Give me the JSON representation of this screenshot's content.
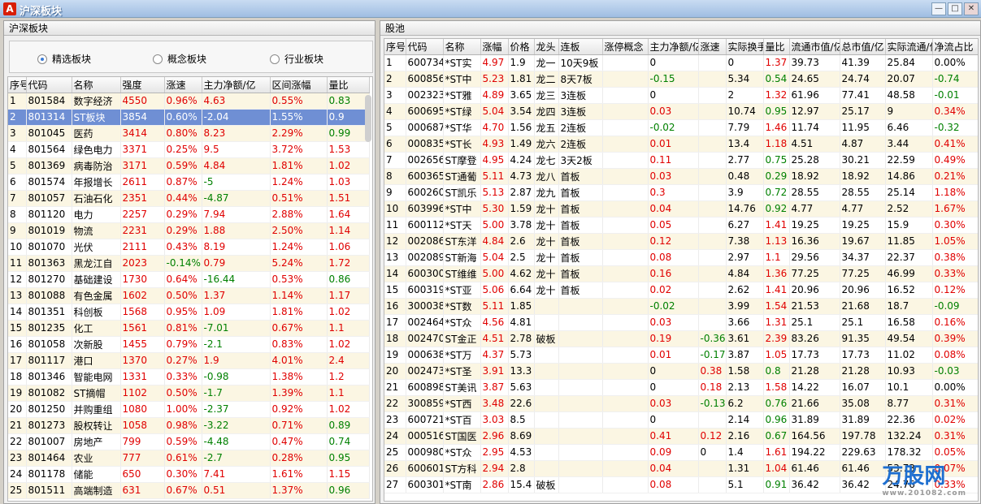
{
  "window": {
    "title": "沪深板块",
    "app_icon_letter": "A"
  },
  "left": {
    "panel_title": "沪深板块",
    "radios": [
      {
        "label": "精选板块",
        "checked": true
      },
      {
        "label": "概念板块",
        "checked": false
      },
      {
        "label": "行业板块",
        "checked": false
      }
    ],
    "columns": [
      "序号",
      "代码",
      "名称",
      "强度",
      "涨速",
      "主力净额/亿",
      "区间涨幅",
      "量比"
    ],
    "rows": [
      [
        "1",
        "801584",
        "数字经济",
        "4550",
        "0.96%",
        "4.63",
        "0.55%",
        "0.83"
      ],
      [
        "2",
        "801314",
        "ST板块",
        "3854",
        "0.60%",
        "-2.04",
        "1.55%",
        "0.9"
      ],
      [
        "3",
        "801045",
        "医药",
        "3414",
        "0.80%",
        "8.23",
        "2.29%",
        "0.99"
      ],
      [
        "4",
        "801564",
        "绿色电力",
        "3371",
        "0.25%",
        "9.5",
        "3.72%",
        "1.53"
      ],
      [
        "5",
        "801369",
        "病毒防治",
        "3171",
        "0.59%",
        "4.84",
        "1.81%",
        "1.02"
      ],
      [
        "6",
        "801574",
        "年报增长",
        "2611",
        "0.87%",
        "-5",
        "1.24%",
        "1.03"
      ],
      [
        "7",
        "801057",
        "石油石化",
        "2351",
        "0.44%",
        "-4.87",
        "0.51%",
        "1.51"
      ],
      [
        "8",
        "801120",
        "电力",
        "2257",
        "0.29%",
        "7.94",
        "2.88%",
        "1.64"
      ],
      [
        "9",
        "801019",
        "物流",
        "2231",
        "0.29%",
        "1.88",
        "2.50%",
        "1.14"
      ],
      [
        "10",
        "801070",
        "光伏",
        "2111",
        "0.43%",
        "8.19",
        "1.24%",
        "1.06"
      ],
      [
        "11",
        "801363",
        "黑龙江自",
        "2023",
        "-0.14%",
        "0.79",
        "5.24%",
        "1.72"
      ],
      [
        "12",
        "801270",
        "基础建设",
        "1730",
        "0.64%",
        "-16.44",
        "0.53%",
        "0.86"
      ],
      [
        "13",
        "801088",
        "有色金属",
        "1602",
        "0.50%",
        "1.37",
        "1.14%",
        "1.17"
      ],
      [
        "14",
        "801351",
        "科创板",
        "1568",
        "0.95%",
        "1.09",
        "1.81%",
        "1.02"
      ],
      [
        "15",
        "801235",
        "化工",
        "1561",
        "0.81%",
        "-7.01",
        "0.67%",
        "1.1"
      ],
      [
        "16",
        "801058",
        "次新股",
        "1455",
        "0.79%",
        "-2.1",
        "0.83%",
        "1.02"
      ],
      [
        "17",
        "801117",
        "港口",
        "1370",
        "0.27%",
        "1.9",
        "4.01%",
        "2.4"
      ],
      [
        "18",
        "801346",
        "智能电网",
        "1331",
        "0.33%",
        "-0.98",
        "1.38%",
        "1.2"
      ],
      [
        "19",
        "801082",
        "ST摘帽",
        "1102",
        "0.50%",
        "-1.7",
        "1.39%",
        "1.1"
      ],
      [
        "20",
        "801250",
        "并购重组",
        "1080",
        "1.00%",
        "-2.37",
        "0.92%",
        "1.02"
      ],
      [
        "21",
        "801273",
        "股权转让",
        "1058",
        "0.98%",
        "-3.22",
        "0.71%",
        "0.89"
      ],
      [
        "22",
        "801007",
        "房地产",
        "799",
        "0.59%",
        "-4.48",
        "0.47%",
        "0.74"
      ],
      [
        "23",
        "801464",
        "农业",
        "777",
        "0.61%",
        "-2.7",
        "0.28%",
        "0.95"
      ],
      [
        "24",
        "801178",
        "储能",
        "650",
        "0.30%",
        "7.41",
        "1.61%",
        "1.15"
      ],
      [
        "25",
        "801511",
        "高端制造",
        "631",
        "0.67%",
        "0.51",
        "1.37%",
        "0.96"
      ]
    ]
  },
  "right": {
    "panel_title": "股池",
    "columns": [
      "序号",
      "代码",
      "名称",
      "涨幅",
      "价格",
      "龙头",
      "连板",
      "涨停概念",
      "主力净额/亿",
      "涨速",
      "实际换手",
      "量比",
      "流通市值/亿",
      "总市值/亿",
      "实际流通/亿",
      "净流占比"
    ],
    "rows": [
      [
        "1",
        "600734",
        "*ST实",
        "4.97",
        "1.9",
        "龙一",
        "10天9板",
        "",
        "0",
        "",
        "0",
        "1.37",
        "39.73",
        "41.39",
        "25.84",
        "0.00%"
      ],
      [
        "2",
        "600856",
        "*ST中",
        "5.23",
        "1.81",
        "龙二",
        "8天7板",
        "",
        "-0.15",
        "",
        "5.34",
        "0.54",
        "24.65",
        "24.74",
        "20.07",
        "-0.74"
      ],
      [
        "3",
        "002323",
        "*ST雅",
        "4.89",
        "3.65",
        "龙三",
        "3连板",
        "",
        "0",
        "",
        "2",
        "1.32",
        "61.96",
        "77.41",
        "48.58",
        "-0.01"
      ],
      [
        "4",
        "600695",
        "*ST绿",
        "5.04",
        "3.54",
        "龙四",
        "3连板",
        "",
        "0.03",
        "",
        "10.74",
        "0.95",
        "12.97",
        "25.17",
        "9",
        "0.34%"
      ],
      [
        "5",
        "000687",
        "*ST华",
        "4.70",
        "1.56",
        "龙五",
        "2连板",
        "",
        "-0.02",
        "",
        "7.79",
        "1.46",
        "11.74",
        "11.95",
        "6.46",
        "-0.32"
      ],
      [
        "6",
        "000835",
        "*ST长",
        "4.93",
        "1.49",
        "龙六",
        "2连板",
        "",
        "0.01",
        "",
        "13.4",
        "1.18",
        "4.51",
        "4.87",
        "3.44",
        "0.41%"
      ],
      [
        "7",
        "002656",
        "ST摩登",
        "4.95",
        "4.24",
        "龙七",
        "3天2板",
        "",
        "0.11",
        "",
        "2.77",
        "0.75",
        "25.28",
        "30.21",
        "22.59",
        "0.49%"
      ],
      [
        "8",
        "600365",
        "ST通葡",
        "5.11",
        "4.73",
        "龙八",
        "首板",
        "",
        "0.03",
        "",
        "0.48",
        "0.29",
        "18.92",
        "18.92",
        "14.86",
        "0.21%"
      ],
      [
        "9",
        "600260",
        "ST凯乐",
        "5.13",
        "2.87",
        "龙九",
        "首板",
        "",
        "0.3",
        "",
        "3.9",
        "0.72",
        "28.55",
        "28.55",
        "25.14",
        "1.18%"
      ],
      [
        "10",
        "603996",
        "*ST中",
        "5.30",
        "1.59",
        "龙十",
        "首板",
        "",
        "0.04",
        "",
        "14.76",
        "0.92",
        "4.77",
        "4.77",
        "2.52",
        "1.67%"
      ],
      [
        "11",
        "600112",
        "*ST天",
        "5.00",
        "3.78",
        "龙十",
        "首板",
        "",
        "0.05",
        "",
        "6.27",
        "1.41",
        "19.25",
        "19.25",
        "15.9",
        "0.30%"
      ],
      [
        "12",
        "002086",
        "ST东洋",
        "4.84",
        "2.6",
        "龙十",
        "首板",
        "",
        "0.12",
        "",
        "7.38",
        "1.13",
        "16.36",
        "19.67",
        "11.85",
        "1.05%"
      ],
      [
        "13",
        "002089",
        "ST新海",
        "5.04",
        "2.5",
        "龙十",
        "首板",
        "",
        "0.08",
        "",
        "2.97",
        "1.1",
        "29.56",
        "34.37",
        "22.37",
        "0.38%"
      ],
      [
        "14",
        "600300",
        "ST维维",
        "5.00",
        "4.62",
        "龙十",
        "首板",
        "",
        "0.16",
        "",
        "4.84",
        "1.36",
        "77.25",
        "77.25",
        "46.99",
        "0.33%"
      ],
      [
        "15",
        "600319",
        "*ST亚",
        "5.06",
        "6.64",
        "龙十",
        "首板",
        "",
        "0.02",
        "",
        "2.62",
        "1.41",
        "20.96",
        "20.96",
        "16.52",
        "0.12%"
      ],
      [
        "16",
        "300038",
        "*ST数",
        "5.11",
        "1.85",
        "",
        "",
        "",
        "-0.02",
        "",
        "3.99",
        "1.54",
        "21.53",
        "21.68",
        "18.7",
        "-0.09"
      ],
      [
        "17",
        "002464",
        "*ST众",
        "4.56",
        "4.81",
        "",
        "",
        "",
        "0.03",
        "",
        "3.66",
        "1.31",
        "25.1",
        "25.1",
        "16.58",
        "0.16%"
      ],
      [
        "18",
        "002470",
        "ST金正",
        "4.51",
        "2.78",
        "破板",
        "",
        "",
        "0.19",
        "-0.36",
        "3.61",
        "2.39",
        "83.26",
        "91.35",
        "49.54",
        "0.39%"
      ],
      [
        "19",
        "000638",
        "*ST万",
        "4.37",
        "5.73",
        "",
        "",
        "",
        "0.01",
        "-0.17",
        "3.87",
        "1.05",
        "17.73",
        "17.73",
        "11.02",
        "0.08%"
      ],
      [
        "20",
        "002473",
        "*ST圣",
        "3.91",
        "13.3",
        "",
        "",
        "",
        "0",
        "0.38",
        "1.58",
        "0.8",
        "21.28",
        "21.28",
        "10.93",
        "-0.03"
      ],
      [
        "21",
        "600898",
        "ST美讯",
        "3.87",
        "5.63",
        "",
        "",
        "",
        "0",
        "0.18",
        "2.13",
        "1.58",
        "14.22",
        "16.07",
        "10.1",
        "0.00%"
      ],
      [
        "22",
        "300859",
        "*ST西",
        "3.48",
        "22.6",
        "",
        "",
        "",
        "0.03",
        "-0.13",
        "6.2",
        "0.76",
        "21.66",
        "35.08",
        "8.77",
        "0.31%"
      ],
      [
        "23",
        "600721",
        "*ST百",
        "3.03",
        "8.5",
        "",
        "",
        "",
        "0",
        "",
        "2.14",
        "0.96",
        "31.89",
        "31.89",
        "22.36",
        "0.02%"
      ],
      [
        "24",
        "000516",
        "ST国医",
        "2.96",
        "8.69",
        "",
        "",
        "",
        "0.41",
        "0.12",
        "2.16",
        "0.67",
        "164.56",
        "197.78",
        "132.24",
        "0.31%"
      ],
      [
        "25",
        "000980",
        "*ST众",
        "2.95",
        "4.53",
        "",
        "",
        "",
        "0.09",
        "0",
        "1.4",
        "1.61",
        "194.22",
        "229.63",
        "178.32",
        "0.05%"
      ],
      [
        "26",
        "600601",
        "ST方科",
        "2.94",
        "2.8",
        "",
        "",
        "",
        "0.04",
        "",
        "1.31",
        "1.04",
        "61.46",
        "61.46",
        "53.73",
        "0.07%"
      ],
      [
        "27",
        "600301",
        "*ST南",
        "2.86",
        "15.4",
        "破板",
        "",
        "",
        "0.08",
        "",
        "5.1",
        "0.91",
        "36.42",
        "36.42",
        "24.76",
        "0.33%"
      ]
    ]
  },
  "colors": {
    "up": "#e00000",
    "down": "#008000",
    "selected_row": "#6f8fd4",
    "alt_row": "#fbf6e3"
  },
  "watermark": {
    "text": "万股网",
    "sub": "www.201082.com"
  }
}
